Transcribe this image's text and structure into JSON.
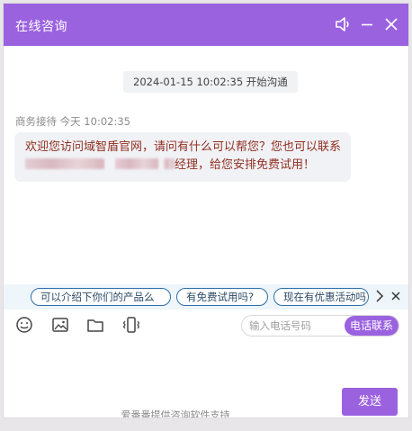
{
  "window": {
    "title": "在线咨询",
    "controls": [
      {
        "name": "volume-icon"
      },
      {
        "name": "minimize-icon"
      },
      {
        "name": "close-icon"
      }
    ]
  },
  "chat": {
    "timestamp_text": "2024-01-15 10:02:35 开始沟通",
    "message": {
      "sender": "商务接待",
      "time": "今天 10:02:35",
      "text_part1": "欢迎您访问域智盾官网，请问有什么可以帮您？您也可以联系",
      "text_part2": "经理，给您安排免费试用！"
    }
  },
  "suggestions": {
    "items": [
      "可以介绍下你们的产品么",
      "有免费试用吗?",
      "现在有优惠活动吗"
    ],
    "next_icon": "chevron-right-icon",
    "close_icon": "close-icon"
  },
  "toolbar": {
    "icons": [
      "emoji-icon",
      "image-icon",
      "folder-icon",
      "vibrate-icon"
    ],
    "phone_placeholder": "输入电话号码",
    "phone_button_label": "电话联系"
  },
  "composer": {
    "send_label": "发送"
  },
  "footer": {
    "note": "爱番番提供咨询软件支持"
  },
  "colors": {
    "accent": "#9b62e0",
    "message_text": "#8f2f1f",
    "chip_border": "#2f6fa8"
  }
}
